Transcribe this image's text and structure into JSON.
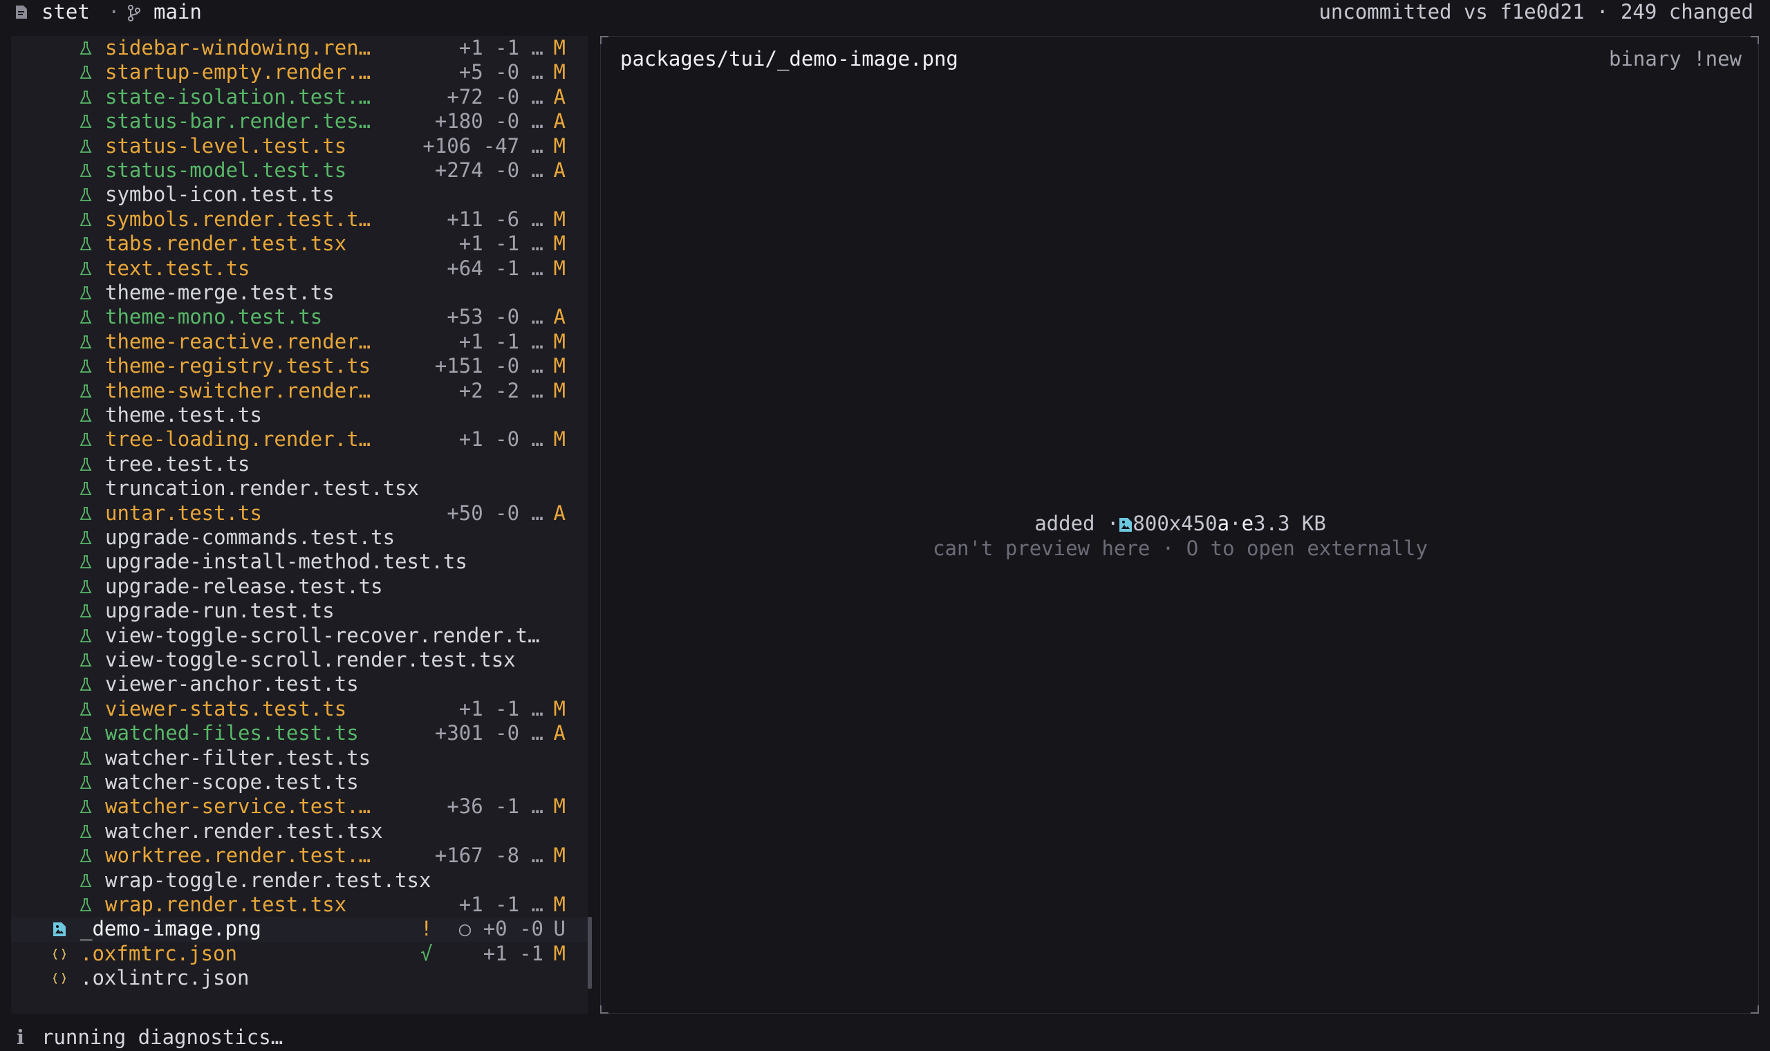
{
  "header": {
    "app_name": "stet",
    "separator": "·",
    "branch": "main",
    "status": "uncommitted vs f1e0d21 · 249 changed"
  },
  "colors": {
    "modified": "#e9a739",
    "added": "#58b868",
    "normal": "#d6d6de",
    "muted": "#a2a2ad",
    "accent": "#6ec9e0"
  },
  "file_list": [
    {
      "name": "sidebar-windowing.ren…",
      "stats": "+1 -1 …",
      "badge": "M",
      "status": "modified",
      "icon": "flask-icon"
    },
    {
      "name": "startup-empty.render.…",
      "stats": "+5 -0 …",
      "badge": "M",
      "status": "modified",
      "icon": "flask-icon"
    },
    {
      "name": "state-isolation.test.…",
      "stats": "+72 -0 …",
      "badge": "A",
      "status": "added",
      "icon": "flask-icon"
    },
    {
      "name": "status-bar.render.tes…",
      "stats": "+180 -0 …",
      "badge": "A",
      "status": "added",
      "icon": "flask-icon"
    },
    {
      "name": "status-level.test.ts",
      "stats": "+106 -47 …",
      "badge": "M",
      "status": "modified",
      "icon": "flask-icon"
    },
    {
      "name": "status-model.test.ts",
      "stats": "+274 -0 …",
      "badge": "A",
      "status": "added",
      "icon": "flask-icon"
    },
    {
      "name": "symbol-icon.test.ts",
      "stats": "",
      "badge": "",
      "status": "normal",
      "icon": "flask-icon"
    },
    {
      "name": "symbols.render.test.t…",
      "stats": "+11 -6 …",
      "badge": "M",
      "status": "modified",
      "icon": "flask-icon"
    },
    {
      "name": "tabs.render.test.tsx",
      "stats": "+1 -1 …",
      "badge": "M",
      "status": "modified",
      "icon": "flask-icon"
    },
    {
      "name": "text.test.ts",
      "stats": "+64 -1 …",
      "badge": "M",
      "status": "modified",
      "icon": "flask-icon"
    },
    {
      "name": "theme-merge.test.ts",
      "stats": "",
      "badge": "",
      "status": "normal",
      "icon": "flask-icon"
    },
    {
      "name": "theme-mono.test.ts",
      "stats": "+53 -0 …",
      "badge": "A",
      "status": "added",
      "icon": "flask-icon"
    },
    {
      "name": "theme-reactive.render…",
      "stats": "+1 -1 …",
      "badge": "M",
      "status": "modified",
      "icon": "flask-icon"
    },
    {
      "name": "theme-registry.test.ts",
      "stats": "+151 -0 …",
      "badge": "M",
      "status": "modified",
      "icon": "flask-icon"
    },
    {
      "name": "theme-switcher.render…",
      "stats": "+2 -2 …",
      "badge": "M",
      "status": "modified",
      "icon": "flask-icon"
    },
    {
      "name": "theme.test.ts",
      "stats": "",
      "badge": "",
      "status": "normal",
      "icon": "flask-icon"
    },
    {
      "name": "tree-loading.render.t…",
      "stats": "+1 -0 …",
      "badge": "M",
      "status": "modified",
      "icon": "flask-icon"
    },
    {
      "name": "tree.test.ts",
      "stats": "",
      "badge": "",
      "status": "normal",
      "icon": "flask-icon"
    },
    {
      "name": "truncation.render.test.tsx",
      "stats": "",
      "badge": "",
      "status": "normal",
      "icon": "flask-icon"
    },
    {
      "name": "untar.test.ts",
      "stats": "+50 -0 …",
      "badge": "A",
      "status": "modified",
      "icon": "flask-icon"
    },
    {
      "name": "upgrade-commands.test.ts",
      "stats": "",
      "badge": "",
      "status": "normal",
      "icon": "flask-icon"
    },
    {
      "name": "upgrade-install-method.test.ts",
      "stats": "",
      "badge": "",
      "status": "normal",
      "icon": "flask-icon"
    },
    {
      "name": "upgrade-release.test.ts",
      "stats": "",
      "badge": "",
      "status": "normal",
      "icon": "flask-icon"
    },
    {
      "name": "upgrade-run.test.ts",
      "stats": "",
      "badge": "",
      "status": "normal",
      "icon": "flask-icon"
    },
    {
      "name": "view-toggle-scroll-recover.render.t…",
      "stats": "",
      "badge": "",
      "status": "normal",
      "icon": "flask-icon"
    },
    {
      "name": "view-toggle-scroll.render.test.tsx",
      "stats": "",
      "badge": "",
      "status": "normal",
      "icon": "flask-icon"
    },
    {
      "name": "viewer-anchor.test.ts",
      "stats": "",
      "badge": "",
      "status": "normal",
      "icon": "flask-icon"
    },
    {
      "name": "viewer-stats.test.ts",
      "stats": "+1 -1 …",
      "badge": "M",
      "status": "modified",
      "icon": "flask-icon"
    },
    {
      "name": "watched-files.test.ts",
      "stats": "+301 -0 …",
      "badge": "A",
      "status": "added",
      "icon": "flask-icon"
    },
    {
      "name": "watcher-filter.test.ts",
      "stats": "",
      "badge": "",
      "status": "normal",
      "icon": "flask-icon"
    },
    {
      "name": "watcher-scope.test.ts",
      "stats": "",
      "badge": "",
      "status": "normal",
      "icon": "flask-icon"
    },
    {
      "name": "watcher-service.test.…",
      "stats": "+36 -1 …",
      "badge": "M",
      "status": "modified",
      "icon": "flask-icon"
    },
    {
      "name": "watcher.render.test.tsx",
      "stats": "",
      "badge": "",
      "status": "normal",
      "icon": "flask-icon"
    },
    {
      "name": "worktree.render.test.…",
      "stats": "+167 -8 …",
      "badge": "M",
      "status": "modified",
      "icon": "flask-icon"
    },
    {
      "name": "wrap-toggle.render.test.tsx",
      "stats": "",
      "badge": "",
      "status": "normal",
      "icon": "flask-icon"
    },
    {
      "name": "wrap.render.test.tsx",
      "stats": "+1 -1 …",
      "badge": "M",
      "status": "modified",
      "icon": "flask-icon"
    },
    {
      "name": "_demo-image.png",
      "stats": "○ +0 -0",
      "badge": "U",
      "status": "untracked",
      "icon": "image-file-icon",
      "extra": "!",
      "extra_color": "#e9a739",
      "selected": true
    },
    {
      "name": ".oxfmtrc.json",
      "stats": "+1 -1",
      "badge": "M",
      "status": "modified",
      "icon": "json-icon",
      "extra": "√",
      "extra_color": "#58b868"
    },
    {
      "name": ".oxlintrc.json",
      "stats": "",
      "badge": "",
      "status": "normal",
      "icon": "json-icon"
    }
  ],
  "preview": {
    "path": "packages/tui/_demo-image.png",
    "flags": "binary !new",
    "summary_prefix": "added ·",
    "dimensions": "800x450",
    "tail_a": "a",
    "dot": "·",
    "tail_e": "e",
    "size": "3.3 KB",
    "hint": "can't preview here · O to open externally"
  },
  "footer": {
    "icon": "info-icon",
    "text": "running diagnostics…"
  }
}
